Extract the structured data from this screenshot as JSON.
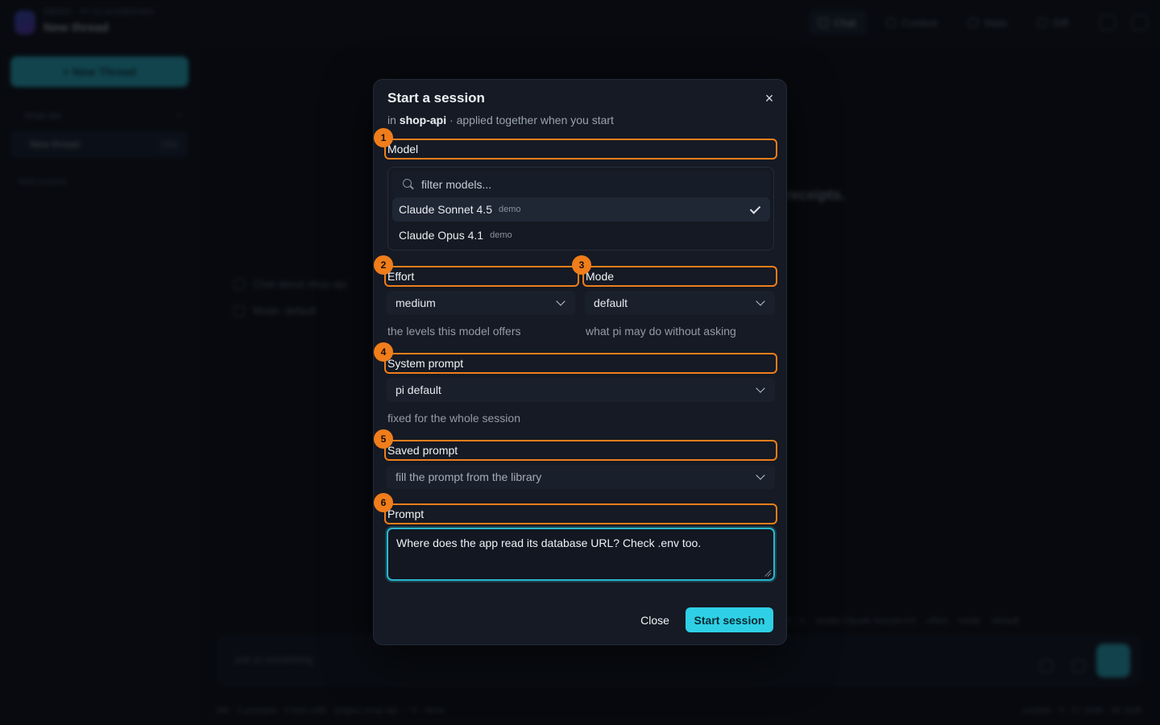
{
  "background": {
    "header": {
      "workspace_label": "DEMO · PI CLAUDEKING",
      "thread_title": "New thread"
    },
    "toolbar": [
      "Chat",
      "Context",
      "Stats",
      "Diff"
    ],
    "sidebar": {
      "new_thread_label": "+ New Thread",
      "workspace_name": "shop-api",
      "thread_label": "New thread",
      "thread_badge": "now",
      "link_label": "Add project"
    },
    "main": {
      "headline": "receipts.",
      "hint_1": "Chat about shop-api",
      "hint_2": "Mode: default"
    },
    "statusline": [
      "0 ↑ 0",
      "model Claude Sonnet 4.5",
      "effort",
      "mode",
      "default"
    ],
    "composer_placeholder": "ask pi something",
    "footer_left": "idle · 0 prompts · 0 tool calls · project shop-api · ↑ 0 · done",
    "footer_right": "context · 0 · 0 / 200k · 0k 200k"
  },
  "modal": {
    "title": "Start a session",
    "subtitle_prefix": "in",
    "workspace": "shop-api",
    "subtitle_suffix": "· applied together when you start",
    "close_icon": "×",
    "fields": {
      "model": {
        "num": "1",
        "label": "Model"
      },
      "effort": {
        "num": "2",
        "label": "Effort",
        "value": "medium",
        "help": "the levels this model offers"
      },
      "mode": {
        "num": "3",
        "label": "Mode",
        "value": "default",
        "help": "what pi may do without asking"
      },
      "system_prompt": {
        "num": "4",
        "label": "System prompt",
        "value": "pi default",
        "help": "fixed for the whole session"
      },
      "saved_prompt": {
        "num": "5",
        "label": "Saved prompt",
        "placeholder": "fill the prompt from the library"
      },
      "prompt": {
        "num": "6",
        "label": "Prompt",
        "value": "Where does the app read its database URL? Check .env too."
      }
    },
    "model_picker": {
      "search_placeholder": "filter models...",
      "options": [
        {
          "name": "Claude Sonnet 4.5",
          "tag": "demo",
          "selected": true
        },
        {
          "name": "Claude Opus 4.1",
          "tag": "demo",
          "selected": false
        }
      ]
    },
    "buttons": {
      "close": "Close",
      "start": "Start session"
    }
  },
  "colors": {
    "accent": "#2fd0e6",
    "highlight": "#f07d1b",
    "modal_bg": "#151a24"
  }
}
